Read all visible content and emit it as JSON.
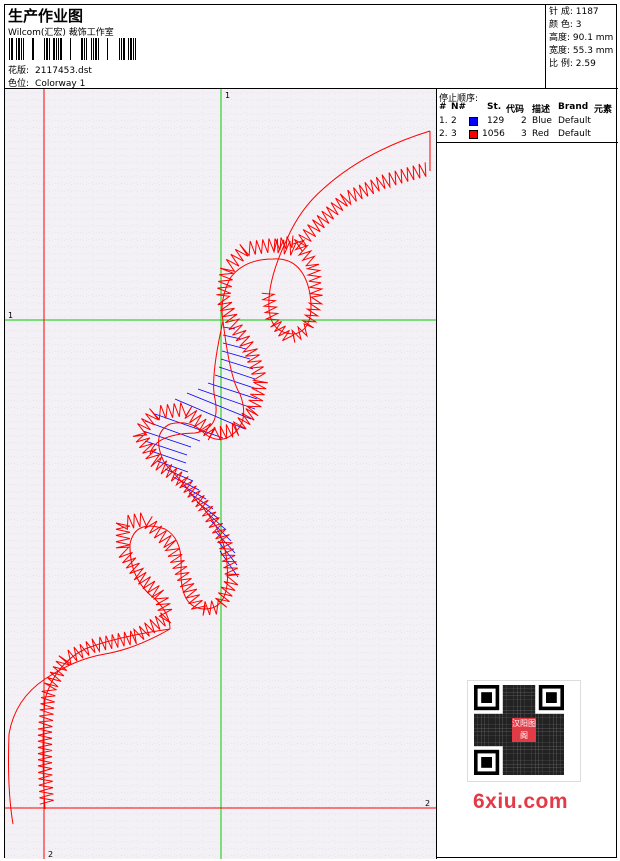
{
  "header": {
    "title": "生产作业图",
    "vendor": "Wilcom(汇宏) 裁饰工作室",
    "design_label": "花版:",
    "design_value": "2117453.dst",
    "colorway_label": "色位:",
    "colorway_value": "Colorway 1"
  },
  "stats": {
    "stitches": "针 成: 1187",
    "colors": "颜 色: 3",
    "height": "高度: 90.1 mm",
    "width": "宽度: 55.3 mm",
    "scale": "比 例: 2.59"
  },
  "stop_sequence": {
    "title": "停止顺序:",
    "columns": [
      "#",
      "N#",
      "St.",
      "代码",
      "描述",
      "Brand",
      "元素"
    ],
    "rows": [
      {
        "idx": "1.",
        "n": "2",
        "color": "#0000ff",
        "stitches": "129",
        "code": "2",
        "desc": "Blue",
        "brand": "Default"
      },
      {
        "idx": "2.",
        "n": "3",
        "color": "#ff0000",
        "stitches": "1056",
        "code": "3",
        "desc": "Red",
        "brand": "Default"
      }
    ]
  },
  "canvas": {
    "axis_labels": {
      "top": "1",
      "left": "1",
      "bottom": "2",
      "right": "2"
    },
    "colors": {
      "guide_green": "#00cc00",
      "guide_red": "#ff0000",
      "stitch_red": "#ff0000",
      "fill_blue": "#0000ff"
    }
  },
  "watermark": {
    "text": "6xiu.com",
    "qr_center": "汉阳图阁"
  }
}
